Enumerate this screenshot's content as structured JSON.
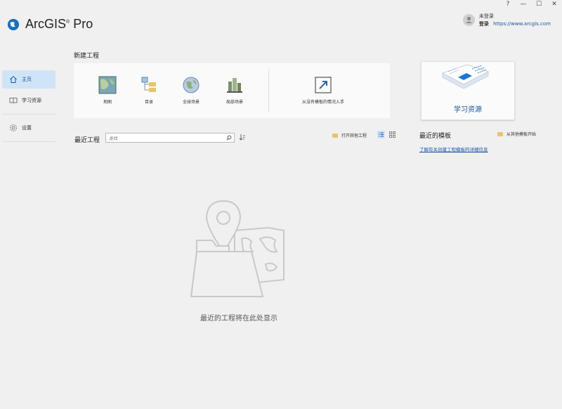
{
  "window": {
    "help": "?",
    "minimize": "—",
    "maximize": "☐",
    "close": "✕"
  },
  "app": {
    "name": "ArcGIS",
    "trademark": "®",
    "product": "Pro"
  },
  "user": {
    "status": "未登录",
    "signin_label": "登录",
    "url": "https://www.arcgis.com"
  },
  "sidebar": {
    "items": [
      {
        "label": "主页",
        "icon": "home-icon",
        "active": true
      },
      {
        "label": "学习资源",
        "icon": "book-icon",
        "active": false
      },
      {
        "label": "设置",
        "icon": "gear-icon",
        "active": false
      }
    ]
  },
  "new_project": {
    "title": "新建工程",
    "tiles": [
      {
        "label": "地图",
        "icon": "map-icon"
      },
      {
        "label": "目录",
        "icon": "catalog-icon"
      },
      {
        "label": "全球场景",
        "icon": "globe-icon"
      },
      {
        "label": "局部场景",
        "icon": "local-scene-icon"
      }
    ],
    "start_without_template": "从没有模板的情况入手"
  },
  "learning": {
    "label": "学习资源"
  },
  "recent_projects": {
    "title": "最近工程",
    "search_placeholder": "查找",
    "open_other": "打开其他工程",
    "empty_message": "最近的工程将在此处显示"
  },
  "recent_templates": {
    "title": "最近的模板",
    "start_other": "从其他模板开始",
    "learn_more_link": "了解有关创建工程模板的详细信息"
  },
  "colors": {
    "accent": "#1a56a0",
    "active_bg": "#cfe4f7",
    "background": "#f0f0f0"
  }
}
